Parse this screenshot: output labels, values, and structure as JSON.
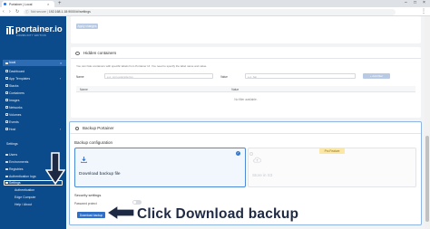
{
  "browser": {
    "tab_title": "Portainer | Local",
    "tab_close": "×",
    "new_tab": "+",
    "window_controls": [
      "–",
      "□",
      "×"
    ],
    "nav": [
      "‹",
      "›",
      "↻"
    ],
    "security": "Not secure",
    "url": "192.168.1.18:9000/#!/settings",
    "menu": "⋮"
  },
  "sidebar": {
    "logo": "portainer.io",
    "logo_sub": "COMMUNITY EDITION",
    "environment": "local",
    "env_close": "×",
    "items": [
      {
        "label": "Dashboard",
        "icon": "dashboard-icon"
      },
      {
        "label": "App Templates",
        "icon": "rocket-icon"
      },
      {
        "label": "Stacks",
        "icon": "layers-icon"
      },
      {
        "label": "Containers",
        "icon": "cube-icon"
      },
      {
        "label": "Images",
        "icon": "image-icon"
      },
      {
        "label": "Networks",
        "icon": "network-icon"
      },
      {
        "label": "Volumes",
        "icon": "database-icon"
      },
      {
        "label": "Events",
        "icon": "history-icon"
      },
      {
        "label": "Host",
        "icon": "server-icon"
      }
    ],
    "settings_section": "Settings",
    "settings_items": [
      {
        "label": "Users"
      },
      {
        "label": "Environments"
      },
      {
        "label": "Registries"
      },
      {
        "label": "Authentication logs"
      },
      {
        "label": "Settings"
      }
    ],
    "settings_sub": [
      {
        "label": "Authentication"
      },
      {
        "label": "Edge Compute"
      },
      {
        "label": "Help / About"
      }
    ],
    "chevron": "›"
  },
  "top_card": {
    "button": "Apply changes"
  },
  "hidden_containers": {
    "title": "Hidden containers",
    "description": "You can hide containers with specific labels from Portainer UI. You need to specify the label name and value.",
    "name_label": "Name",
    "name_placeholder": "e.g. com.example.foo",
    "value_label": "Value",
    "value_placeholder": "e.g. bar",
    "add_button": "+ Add filter",
    "columns": [
      "Name",
      "Value"
    ],
    "empty": "No filter available."
  },
  "backup": {
    "title": "Backup Portainer",
    "config_title": "Backup configuration",
    "check": "✓",
    "option1": "Download backup file",
    "option2": "Store in S3",
    "pro_badge": "Pro Feature",
    "security_title": "Security settings",
    "password_label": "Password protect",
    "button": "Download backup"
  },
  "annotation": {
    "text": "Click Download backup"
  },
  "colors": {
    "sidebar": "#0b4a8b",
    "accent": "#2f6fc7",
    "annotation": "#1e2a44"
  }
}
